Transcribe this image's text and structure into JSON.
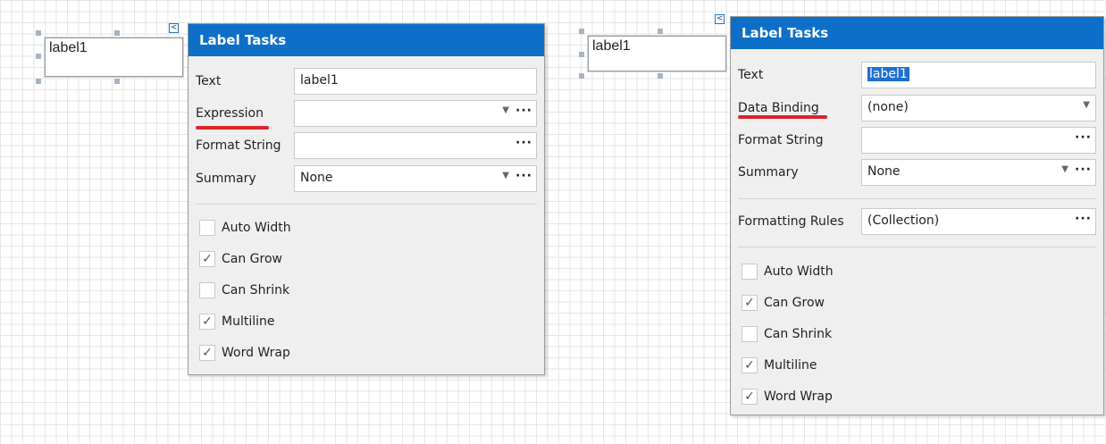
{
  "left": {
    "label_text": "label1",
    "smart_tag_glyph": "<",
    "panel_title": "Label Tasks",
    "rows": {
      "text": {
        "label": "Text",
        "value": "label1"
      },
      "expression": {
        "label": "Expression",
        "value": ""
      },
      "format_string": {
        "label": "Format String",
        "value": ""
      },
      "summary": {
        "label": "Summary",
        "value": "None"
      }
    },
    "checkboxes": [
      {
        "label": "Auto Width",
        "checked": false
      },
      {
        "label": "Can Grow",
        "checked": true
      },
      {
        "label": "Can Shrink",
        "checked": false
      },
      {
        "label": "Multiline",
        "checked": true
      },
      {
        "label": "Word Wrap",
        "checked": true
      }
    ]
  },
  "right": {
    "label_text": "label1",
    "smart_tag_glyph": "<",
    "panel_title": "Label Tasks",
    "rows": {
      "text": {
        "label": "Text",
        "value": "label1"
      },
      "data_binding": {
        "label": "Data Binding",
        "value": "(none)"
      },
      "format_string": {
        "label": "Format String",
        "value": ""
      },
      "summary": {
        "label": "Summary",
        "value": "None"
      },
      "formatting_rules": {
        "label": "Formatting Rules",
        "value": "(Collection)"
      }
    },
    "checkboxes": [
      {
        "label": "Auto Width",
        "checked": false
      },
      {
        "label": "Can Grow",
        "checked": true
      },
      {
        "label": "Can Shrink",
        "checked": false
      },
      {
        "label": "Multiline",
        "checked": true
      },
      {
        "label": "Word Wrap",
        "checked": true
      }
    ]
  },
  "glyphs": {
    "ellipsis": "···",
    "dropdown": "▼",
    "check": "✓"
  },
  "colors": {
    "header": "#0d6fc8",
    "underline": "#d9262c",
    "selection": "#1e6fd0"
  }
}
